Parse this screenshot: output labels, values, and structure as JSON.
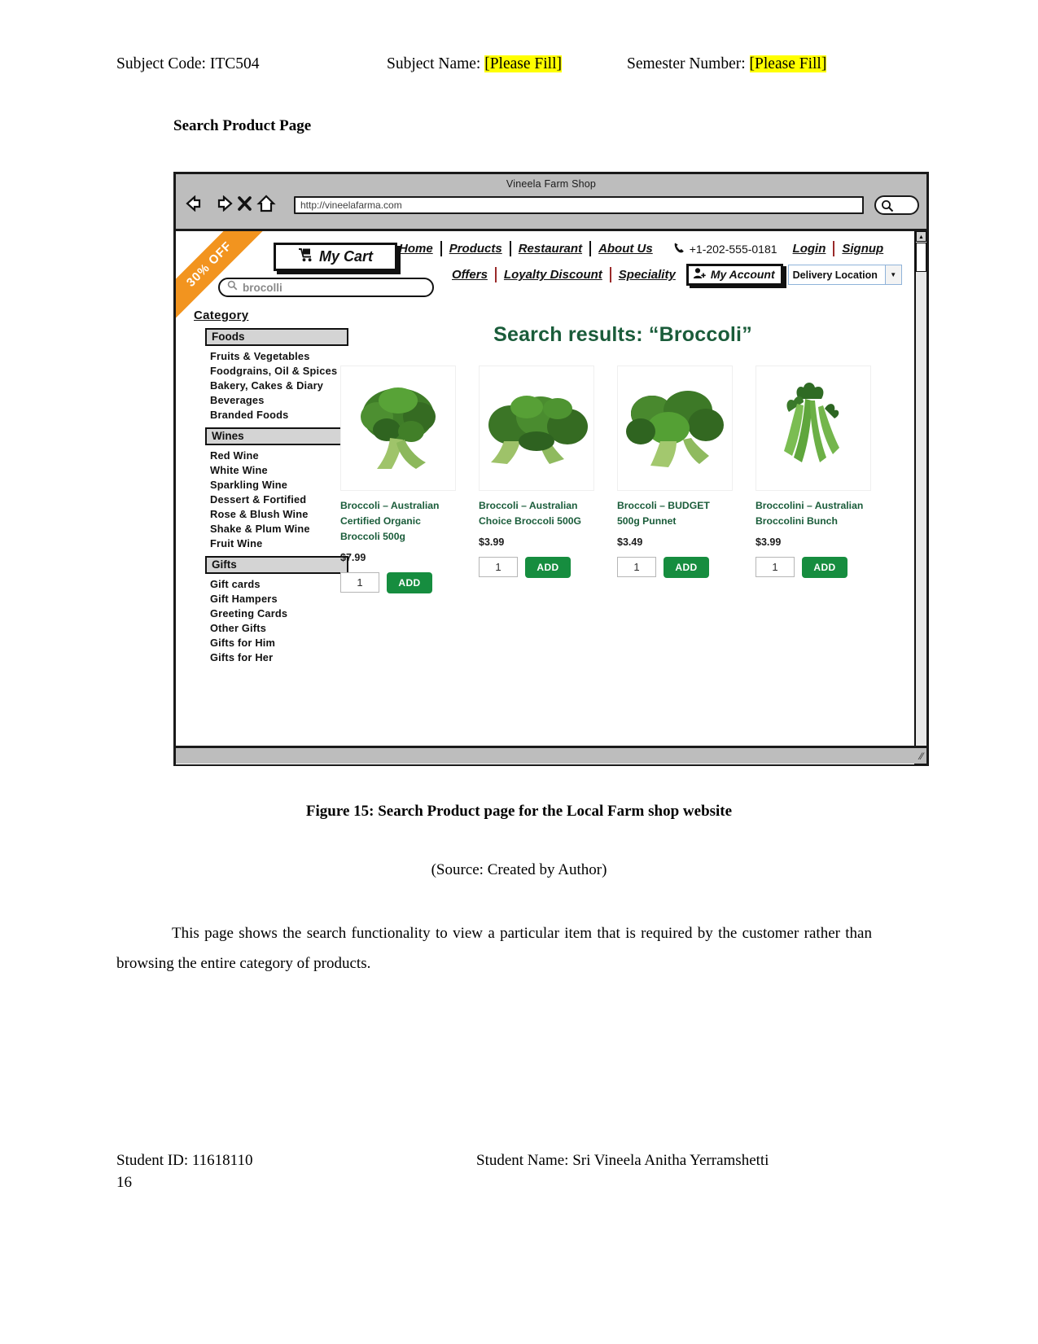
{
  "doc_header": {
    "subject_code_label": "Subject Code: ITC504",
    "subject_name_label": "Subject Name:",
    "subject_name_value": "[Please Fill]",
    "semester_label": "Semester Number:",
    "semester_value": "[Please Fill]"
  },
  "page_title": "Search Product Page",
  "browser": {
    "window_title": "Vineela Farm Shop",
    "url": "http://vineelafarma.com",
    "back_icon": "back-arrow-icon",
    "forward_icon": "forward-arrow-icon",
    "stop_icon": "stop-x-icon",
    "home_icon": "home-icon",
    "search_icon": "search-icon"
  },
  "site": {
    "ribbon": "30% OFF",
    "cart_label": "My Cart",
    "cart_icon": "cart-icon",
    "search": {
      "value": "brocolli",
      "icon": "search-icon"
    },
    "nav_primary": [
      "Home",
      "Products",
      "Restaurant",
      "About Us"
    ],
    "phone": "+1-202-555-0181",
    "phone_icon": "phone-icon",
    "auth": [
      "Login",
      "Signup"
    ],
    "nav_secondary": [
      "Offers",
      "Loyalty Discount",
      "Speciality"
    ],
    "account_label": "My Account",
    "account_icon": "user-add-icon",
    "delivery_label": "Delivery Location",
    "delivery_caret": "chevron-down-icon"
  },
  "sidebar": {
    "title": "Category",
    "groups": [
      {
        "heading": "Foods",
        "items": [
          "Fruits & Vegetables",
          "Foodgrains, Oil & Spices",
          "Bakery, Cakes & Diary",
          "Beverages",
          "Branded Foods"
        ]
      },
      {
        "heading": "Wines",
        "items": [
          "Red Wine",
          "White Wine",
          "Sparkling Wine",
          "Dessert & Fortified",
          "Rose & Blush Wine",
          "Shake & Plum Wine",
          "Fruit Wine"
        ]
      },
      {
        "heading": "Gifts",
        "items": [
          "Gift cards",
          "Gift Hampers",
          "Greeting Cards",
          "Other Gifts",
          "Gifts for Him",
          "Gifts for Her"
        ]
      }
    ]
  },
  "results": {
    "heading": "Search results: “Broccoli”",
    "add_label": "ADD",
    "products": [
      {
        "name": "Broccoli – Australian Certified Organic Broccoli 500g",
        "price": "$7.99",
        "qty": "1",
        "image": "broccoli-head-photo"
      },
      {
        "name": "Broccoli – Australian Choice Broccoli 500G",
        "price": "$3.99",
        "qty": "1",
        "image": "broccoli-florets-photo"
      },
      {
        "name": "Broccoli – BUDGET 500g Punnet",
        "price": "$3.49",
        "qty": "1",
        "image": "broccoli-punnet-photo"
      },
      {
        "name": "Broccolini – Australian Broccolini Bunch",
        "price": "$3.99",
        "qty": "1",
        "image": "broccolini-bunch-photo"
      }
    ]
  },
  "figure_caption": "Figure 15: Search Product page for the Local Farm shop website",
  "source_line": "(Source: Created by Author)",
  "body_paragraph": "This page shows the search functionality to view a particular item that is required by the customer rather than browsing the entire category of products.",
  "footer": {
    "student_id": "Student ID: 11618110",
    "student_name": "Student Name: Sri Vineela Anitha Yerramshetti",
    "page_number": "16"
  },
  "colors": {
    "accent_green": "#168d3f",
    "heading_green": "#1a5c3a",
    "ribbon_orange": "#f2941f",
    "highlight_yellow": "#ffff00"
  }
}
